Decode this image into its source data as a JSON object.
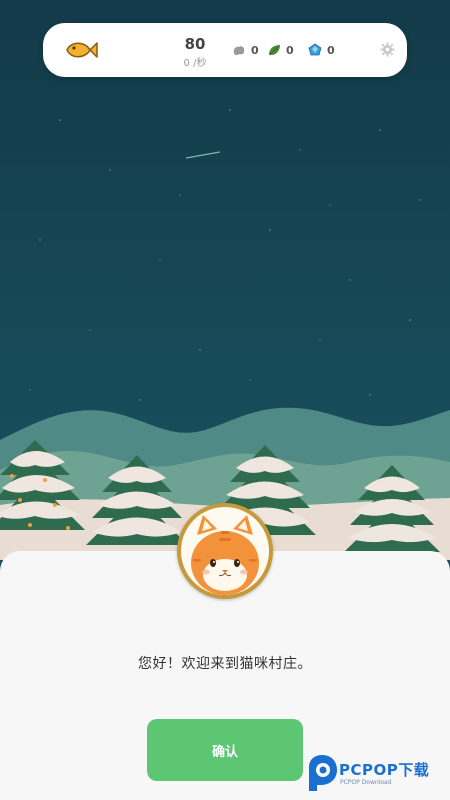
{
  "topbar": {
    "fish_icon": "fish-icon",
    "coins": "80",
    "coin_rate": "0 /秒",
    "resources": [
      {
        "icon": "stone-icon",
        "value": "0"
      },
      {
        "icon": "leaf-icon",
        "value": "0"
      },
      {
        "icon": "gem-icon",
        "value": "0"
      }
    ],
    "settings_icon": "gear-icon"
  },
  "dialog": {
    "avatar_icon": "cat-avatar-icon",
    "message": "您好！欢迎来到猫咪村庄。",
    "confirm_label": "确认"
  },
  "watermark": {
    "brand": "PCPOP下载",
    "sub": "PCPOP Download"
  },
  "colors": {
    "sky": "#174a58",
    "confirm": "#5cc672",
    "avatar_ring": "#c69a3a"
  }
}
